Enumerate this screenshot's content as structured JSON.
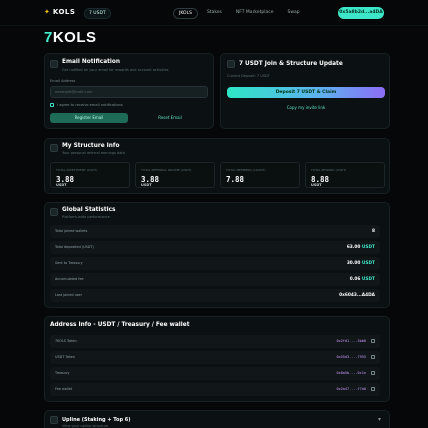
{
  "nav": {
    "brand_name": "KOLS",
    "chip_label": "7 USDT",
    "tabs": [
      {
        "label": "JKOLS"
      },
      {
        "label": "Stakes"
      },
      {
        "label": "NFT Marketplace"
      },
      {
        "label": "Swap"
      }
    ],
    "wallet_label": "0x5a8b2d...a4DA"
  },
  "logo": {
    "seven": "7",
    "rest": "KOLS"
  },
  "email_card": {
    "title": "Email Notification",
    "subtitle": "Get notified on your email for rewards and account activities",
    "field_label": "Email Address",
    "placeholder": "example@mail.com",
    "checkbox_label": "I agree to receive email notifications",
    "primary_button": "Register Email",
    "secondary_button": "Reset Email"
  },
  "join_card": {
    "title": "7 USDT Join & Structure Update",
    "subtitle": "Current Deposit: 7 USDT",
    "deposit_button": "Deposit 7 USDT & Claim",
    "invite_button": "Copy my invite link"
  },
  "structure": {
    "title": "My Structure Info",
    "subtitle": "Your personal referral earnings data",
    "cards": [
      {
        "label": "TOTAL INVESTMENT (USDT)",
        "value": "3.88",
        "unit": "USDT"
      },
      {
        "label": "TOTAL REFERRAL INCOME (USDT)",
        "value": "3.88",
        "unit": "USDT"
      },
      {
        "label": "TOTAL MEMBERS (COUNT)",
        "value": "7.88",
        "unit": ""
      },
      {
        "label": "TOTAL REWARD (USDT)",
        "value": "8.88",
        "unit": "USDT"
      }
    ]
  },
  "global": {
    "title": "Global Statistics",
    "subtitle": "Platform-wide performance",
    "rows": [
      {
        "label": "Total joined wallets",
        "value": "8",
        "unit": ""
      },
      {
        "label": "Total deposited (USDT)",
        "value": "63.00",
        "unit": "USDT"
      },
      {
        "label": "Sent to Treasury",
        "value": "30.00",
        "unit": "USDT"
      },
      {
        "label": "Accumulated fee",
        "value": "0.06",
        "unit": "USDT"
      },
      {
        "label": "Last joined user",
        "value": "0x6043...A4DA",
        "unit": ""
      }
    ]
  },
  "address_info": {
    "title": "Address Info - USDT / Treasury / Fee wallet",
    "rows": [
      {
        "label": "7KOLS Token",
        "address": "0x2fd1....3bb8"
      },
      {
        "label": "USDT Token",
        "address": "0x55d3....7955"
      },
      {
        "label": "Treasury",
        "address": "0x8a5b....0c1e"
      },
      {
        "label": "Fee wallet",
        "address": "0x2a47....f7a0"
      }
    ]
  },
  "upline": {
    "title": "Upline (Staking + Top 6)",
    "subtitle": "View your upline structure"
  }
}
